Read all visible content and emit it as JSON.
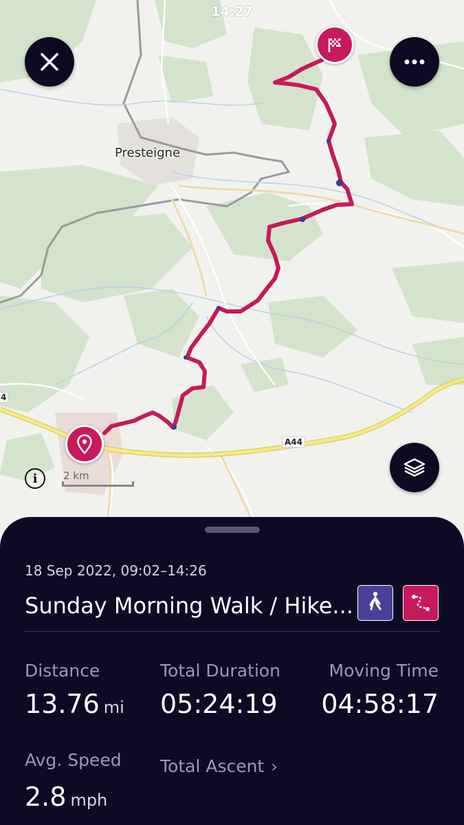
{
  "status_bar": {
    "time": "14:27"
  },
  "map": {
    "town_label": "Presteigne",
    "road_label": "A44",
    "edge_road_label": "4",
    "scale_label": "2 km",
    "info_glyph": "i"
  },
  "toolbar": {
    "close_icon": "close-icon",
    "more_icon": "more-dots-icon",
    "layers_icon": "layers-icon"
  },
  "activity": {
    "date_range": "18 Sep 2022, 09:02–14:26",
    "title": "Sunday Morning Walk / Hike...",
    "activity_type_icon": "walking-person-icon",
    "route_icon": "route-icon"
  },
  "stats": {
    "distance": {
      "label": "Distance",
      "value": "13.76",
      "unit": "mi"
    },
    "total_duration": {
      "label": "Total Duration",
      "value": "05:24:19"
    },
    "moving_time": {
      "label": "Moving Time",
      "value": "04:58:17"
    },
    "avg_speed": {
      "label": "Avg. Speed",
      "value": "2.8",
      "unit": "mph"
    },
    "total_ascent": {
      "label": "Total Ascent"
    }
  },
  "colors": {
    "accent": "#c8195a",
    "panel": "#0d0b24",
    "activity_badge": "#4a4097"
  }
}
